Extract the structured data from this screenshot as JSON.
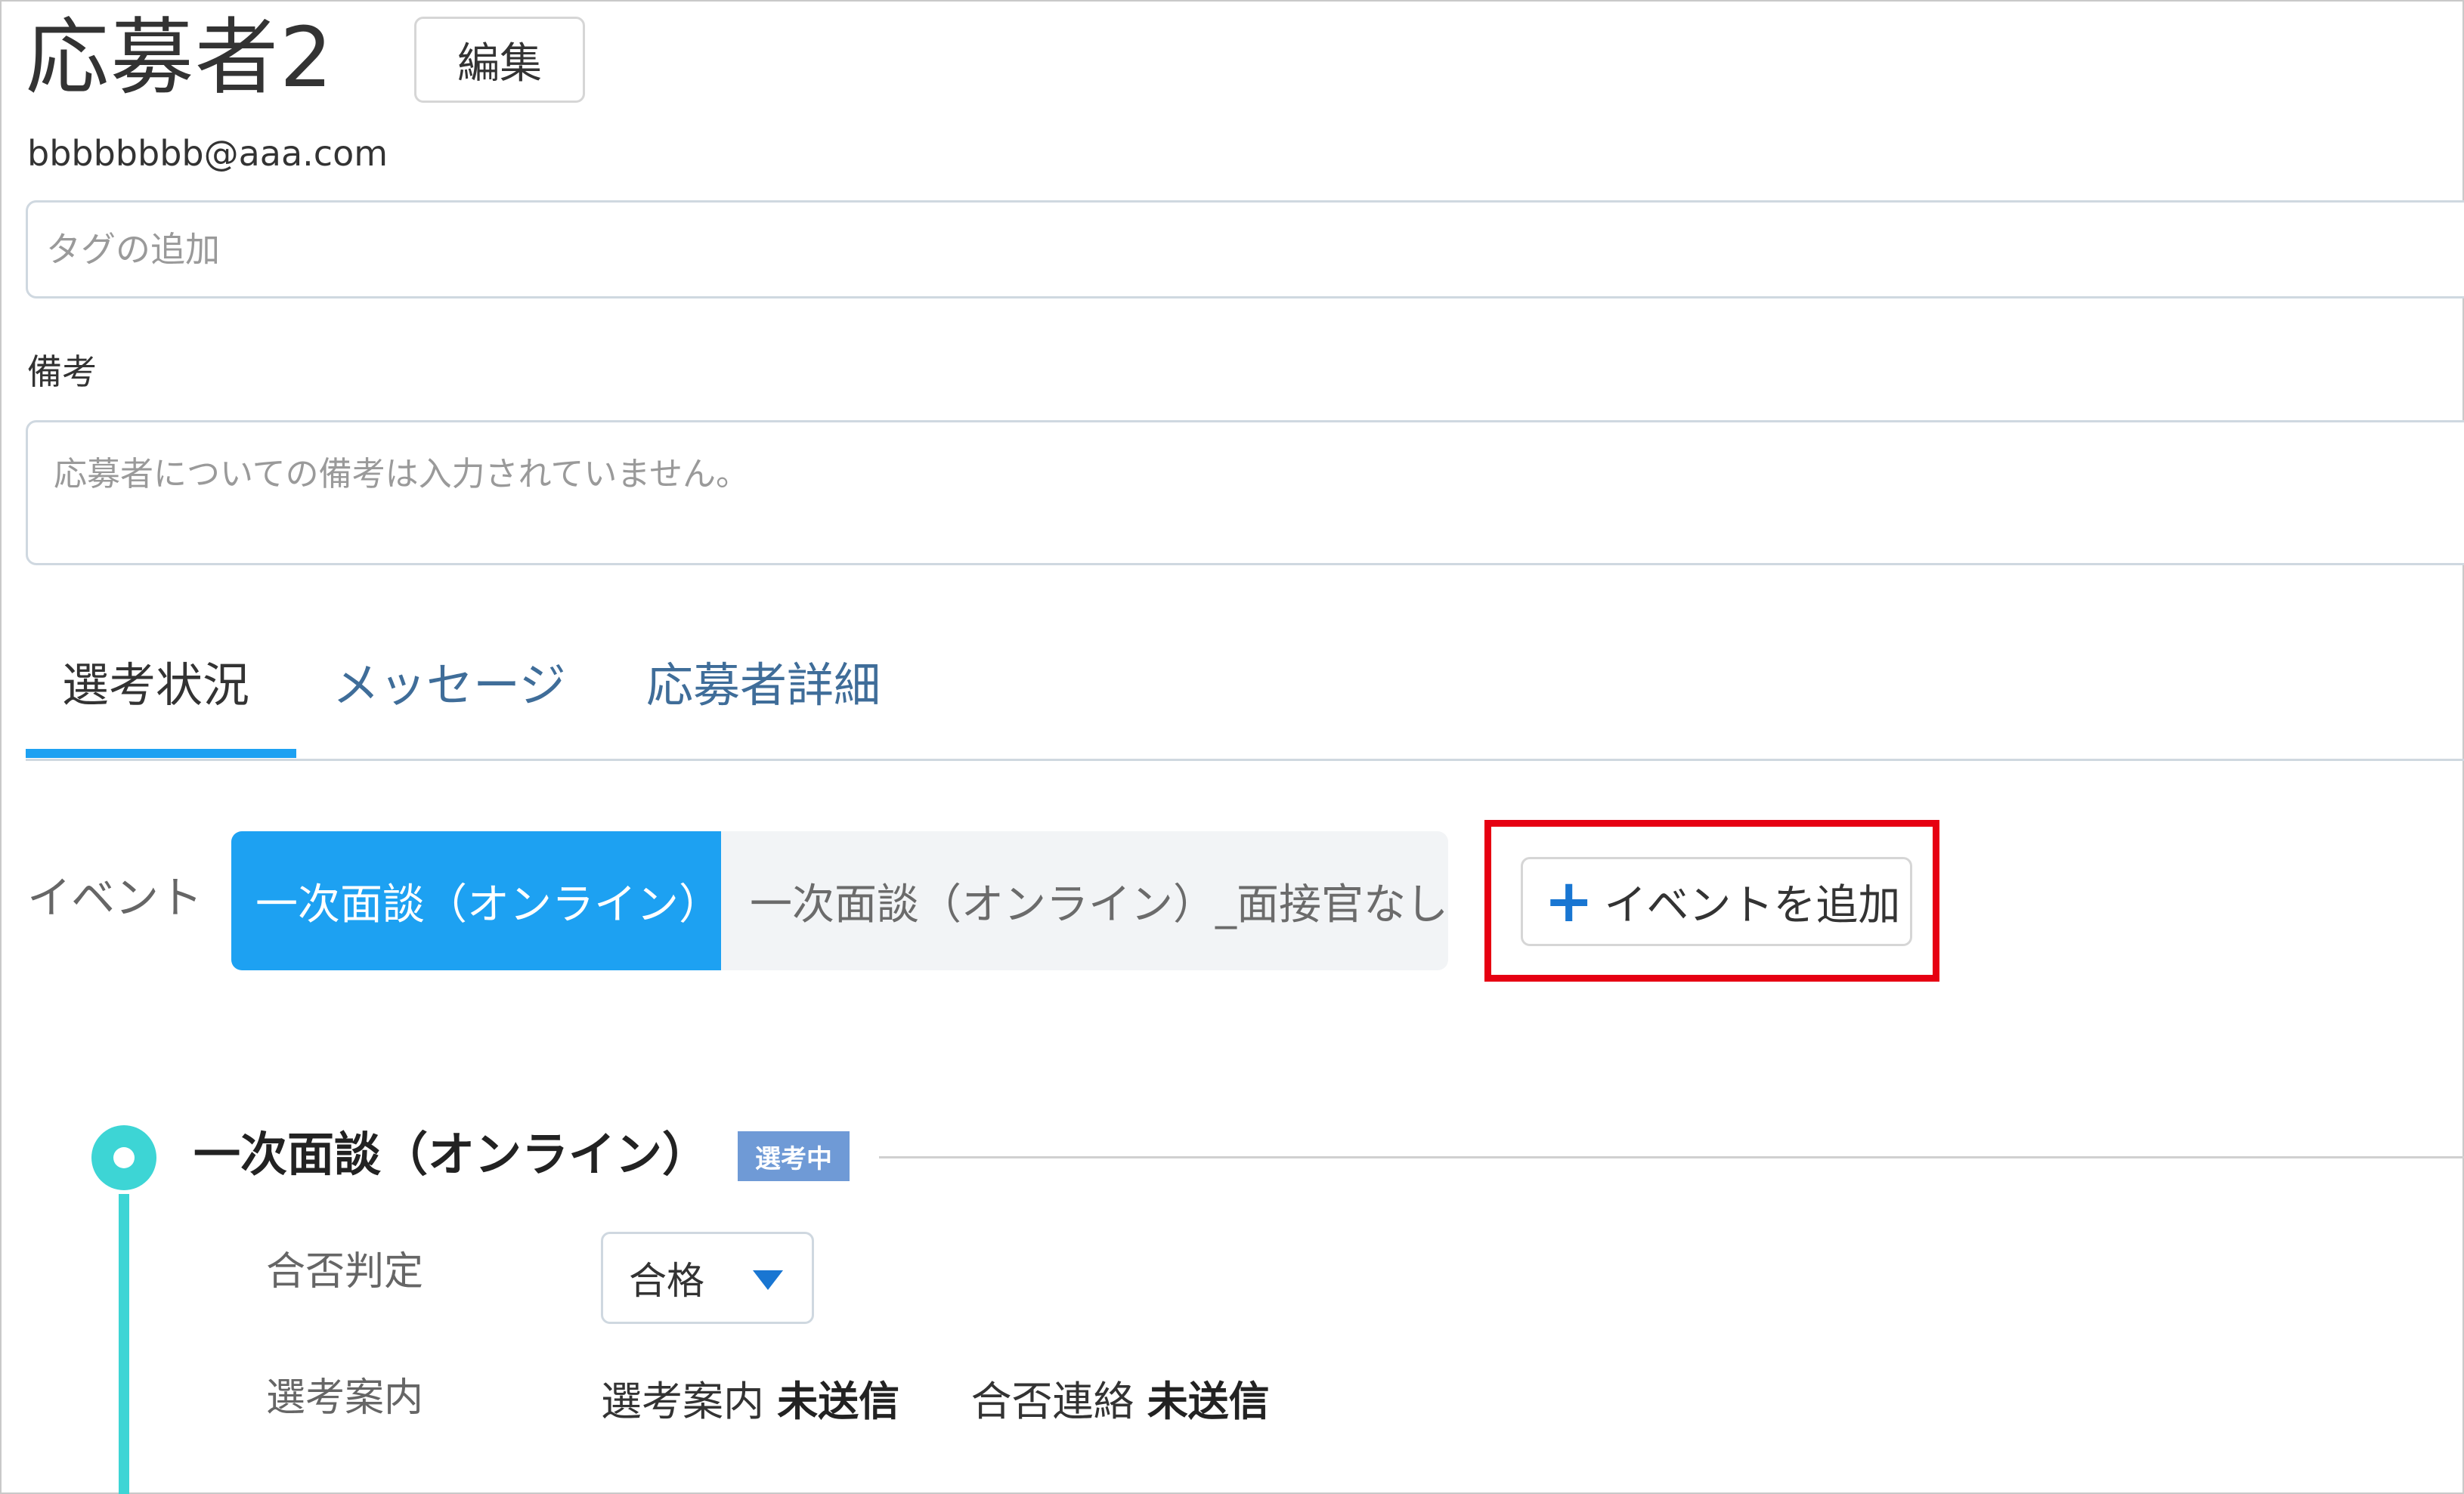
{
  "header": {
    "title": "応募者2",
    "edit_label": "編集",
    "email": "bbbbbbbb@aaa.com"
  },
  "tags": {
    "placeholder": "タグの追加"
  },
  "notes": {
    "label": "備考",
    "placeholder": "応募者についての備考は入力されていません。"
  },
  "tabs": [
    {
      "label": "選考状況",
      "active": true
    },
    {
      "label": "メッセージ",
      "active": false
    },
    {
      "label": "応募者詳細",
      "active": false
    }
  ],
  "events": {
    "label": "イベント",
    "items": [
      {
        "label": "一次面談（オンライン）",
        "selected": true
      },
      {
        "label": "一次面談（オンライン）_面接官なし",
        "selected": false
      }
    ],
    "add_label": "イベントを追加",
    "add_icon": "plus-icon"
  },
  "stage": {
    "title": "一次面談（オンライン）",
    "badge": "選考中",
    "result_label": "合否判定",
    "result_value": "合格",
    "guide_label": "選考案内",
    "guide_status_label": "選考案内",
    "guide_status_value": "未送信",
    "result_notice_label": "合否連絡",
    "result_notice_value": "未送信"
  },
  "colors": {
    "accent": "#1da1f2",
    "link": "#3f6d99",
    "highlight_border": "#e60012",
    "timeline": "#3dd5d5",
    "badge": "#6f9ad6"
  }
}
